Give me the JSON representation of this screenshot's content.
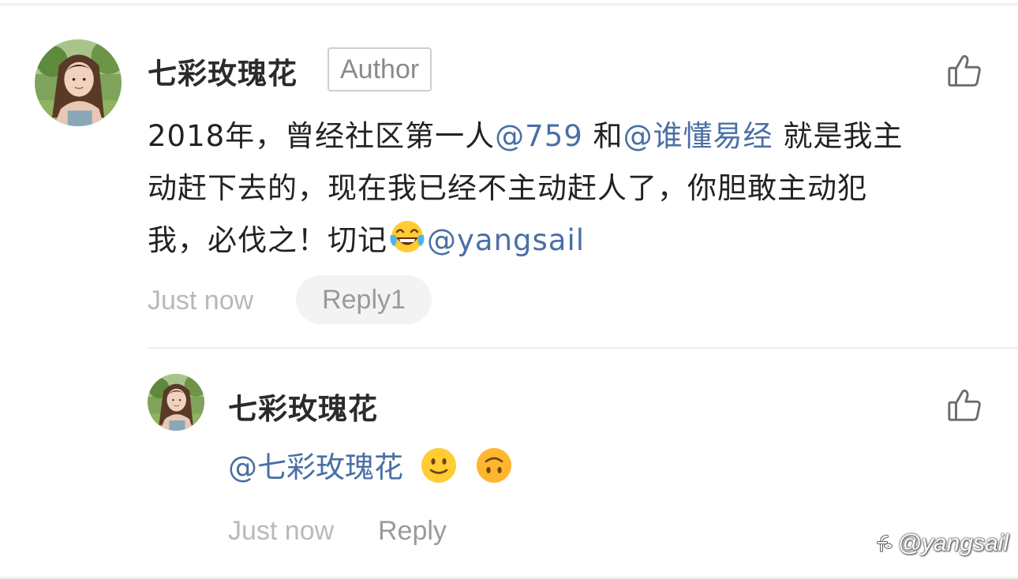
{
  "comment": {
    "author_name": "七彩玫瑰花",
    "author_badge": "Author",
    "body_lines": [
      {
        "text_1": "2018年，曾经社区第一人",
        "mention_1": "@759",
        "text_2": " 和",
        "mention_2": "@谁懂易经",
        "text_3": " 就是我主"
      },
      {
        "text": "动赶下去的，现在我已经不主动赶人了，你胆敢主动犯"
      },
      {
        "text": "我，必伐之！切记",
        "emoji": "laughing-tears-emoji",
        "mention": "@yangsail"
      }
    ],
    "timestamp": "Just now",
    "reply_button_label": "Reply1",
    "like_icon": "thumbs-up-icon"
  },
  "reply": {
    "author_name": "七彩玫瑰花",
    "mention": "@七彩玫瑰花",
    "emojis": [
      "slightly-smiling-emoji",
      "upside-down-smiling-emoji"
    ],
    "timestamp": "Just now",
    "reply_button_label": "Reply",
    "like_icon": "thumbs-up-icon"
  },
  "watermark": {
    "text": "@yangsail"
  },
  "colors": {
    "mention": "#4a6fa5",
    "text": "#222222",
    "muted": "#b9b9b9",
    "pill_bg": "#f3f3f3"
  }
}
